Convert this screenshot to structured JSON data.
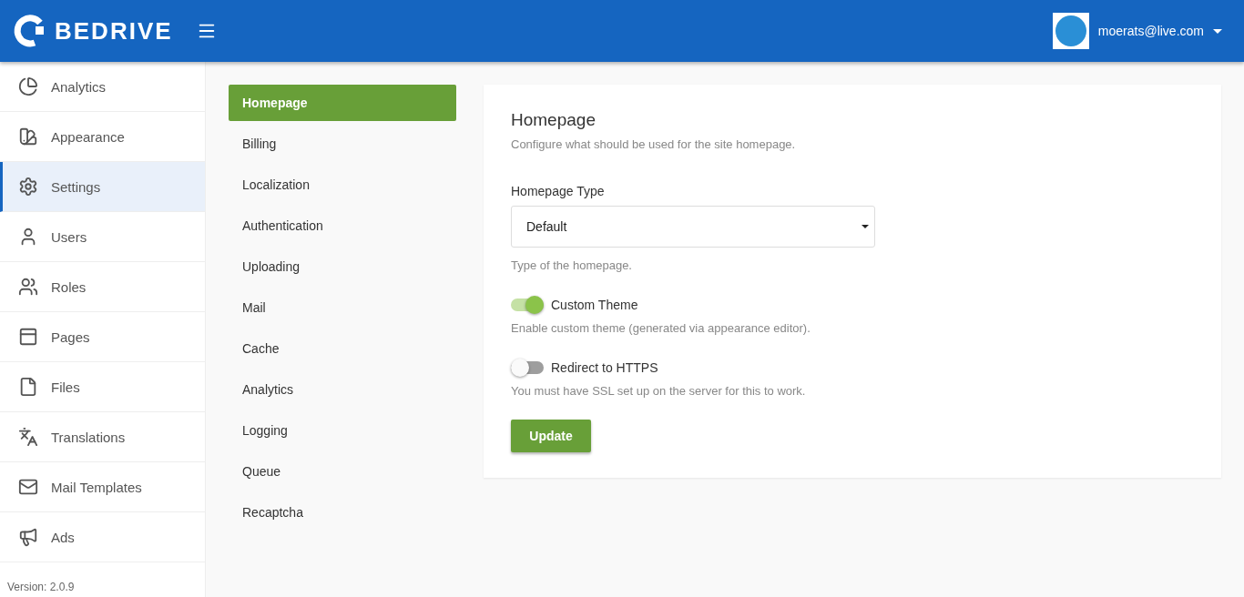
{
  "header": {
    "logo_text": "BEDRIVE",
    "user_email": "moerats@live.com"
  },
  "sidebar": {
    "items": [
      {
        "label": "Analytics",
        "selected": false
      },
      {
        "label": "Appearance",
        "selected": false
      },
      {
        "label": "Settings",
        "selected": true
      },
      {
        "label": "Users",
        "selected": false
      },
      {
        "label": "Roles",
        "selected": false
      },
      {
        "label": "Pages",
        "selected": false
      },
      {
        "label": "Files",
        "selected": false
      },
      {
        "label": "Translations",
        "selected": false
      },
      {
        "label": "Mail Templates",
        "selected": false
      },
      {
        "label": "Ads",
        "selected": false
      }
    ],
    "version": "Version: 2.0.9"
  },
  "settings_nav": [
    {
      "label": "Homepage",
      "selected": true
    },
    {
      "label": "Billing",
      "selected": false
    },
    {
      "label": "Localization",
      "selected": false
    },
    {
      "label": "Authentication",
      "selected": false
    },
    {
      "label": "Uploading",
      "selected": false
    },
    {
      "label": "Mail",
      "selected": false
    },
    {
      "label": "Cache",
      "selected": false
    },
    {
      "label": "Analytics",
      "selected": false
    },
    {
      "label": "Logging",
      "selected": false
    },
    {
      "label": "Queue",
      "selected": false
    },
    {
      "label": "Recaptcha",
      "selected": false
    }
  ],
  "panel": {
    "title": "Homepage",
    "subtitle": "Configure what should be used for the site homepage.",
    "fields": [
      {
        "kind": "select",
        "label": "Homepage Type",
        "value": "Default",
        "hint": "Type of the homepage."
      },
      {
        "kind": "toggle",
        "label": "Custom Theme",
        "on": true,
        "hint": "Enable custom theme (generated via appearance editor)."
      },
      {
        "kind": "toggle",
        "label": "Redirect to HTTPS",
        "on": false,
        "hint": "You must have SSL set up on the server for this to work."
      }
    ],
    "button": "Update"
  }
}
